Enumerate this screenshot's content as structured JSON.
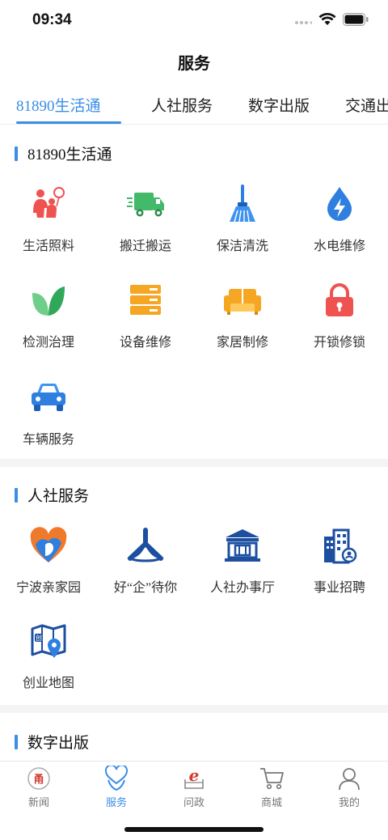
{
  "status_bar": {
    "time": "09:34",
    "icons": [
      "signal-dots-icon",
      "wifi-icon",
      "battery-icon"
    ]
  },
  "header": {
    "title": "服务"
  },
  "tabs": [
    {
      "label": "81890生活通",
      "active": true
    },
    {
      "label": "人社服务",
      "active": false
    },
    {
      "label": "数字出版",
      "active": false
    },
    {
      "label": "交通出行",
      "active": false
    }
  ],
  "sections": {
    "life": {
      "title": "81890生活通",
      "items": [
        {
          "label": "生活照料",
          "icon": "family-care-icon"
        },
        {
          "label": "搬迁搬运",
          "icon": "truck-icon"
        },
        {
          "label": "保洁清洗",
          "icon": "broom-icon"
        },
        {
          "label": "水电维修",
          "icon": "water-electric-icon"
        },
        {
          "label": "检测治理",
          "icon": "leaf-icon"
        },
        {
          "label": "设备维修",
          "icon": "server-icon"
        },
        {
          "label": "家居制修",
          "icon": "sofa-icon"
        },
        {
          "label": "开锁修锁",
          "icon": "lock-icon"
        },
        {
          "label": "车辆服务",
          "icon": "car-icon"
        }
      ]
    },
    "social": {
      "title": "人社服务",
      "items": [
        {
          "label": "宁波亲家园",
          "icon": "heart-face-icon"
        },
        {
          "label": "好“企”待你",
          "icon": "tri-logo-icon"
        },
        {
          "label": "人社办事厅",
          "icon": "hall-building-icon"
        },
        {
          "label": "事业招聘",
          "icon": "office-building-icon"
        },
        {
          "label": "创业地图",
          "icon": "startup-map-icon"
        }
      ]
    },
    "digital": {
      "title": "数字出版"
    }
  },
  "bottom_nav": [
    {
      "label": "新闻",
      "icon": "news-logo-icon",
      "active": false
    },
    {
      "label": "服务",
      "icon": "service-heart-icon",
      "active": true
    },
    {
      "label": "问政",
      "icon": "wenzheng-e-icon",
      "active": false
    },
    {
      "label": "商城",
      "icon": "cart-icon",
      "active": false
    },
    {
      "label": "我的",
      "icon": "user-icon",
      "active": false
    }
  ],
  "colors": {
    "accent": "#3a8ee6",
    "red": "#ef5350",
    "green": "#43b96a",
    "orange": "#f5a623",
    "blue": "#2e7fe0",
    "navy": "#1d4fa0"
  }
}
